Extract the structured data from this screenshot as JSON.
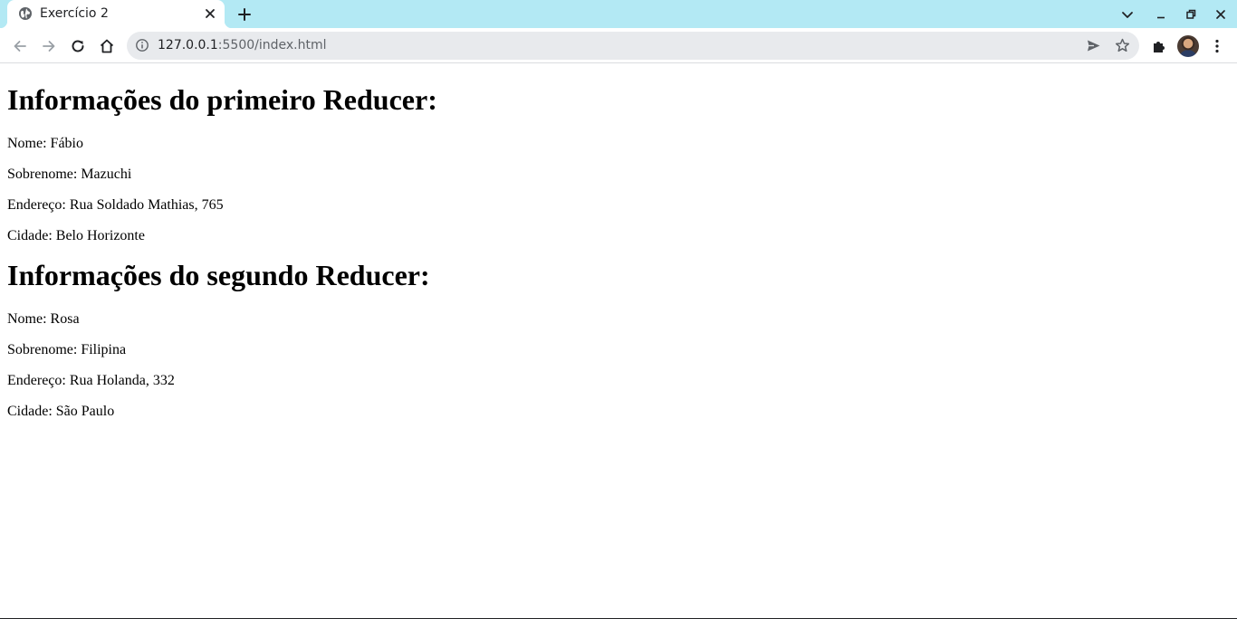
{
  "browser": {
    "tab": {
      "title": "Exercício 2",
      "favicon": "globe-icon"
    },
    "address_bar": {
      "host": "127.0.0.1",
      "rest": ":5500/index.html"
    },
    "icons": [
      "back-arrow-icon",
      "forward-arrow-icon",
      "reload-icon",
      "home-icon",
      "info-icon",
      "send-icon",
      "star-icon",
      "extensions-puzzle-icon",
      "kebab-menu-icon",
      "tab-search-chevron-icon",
      "minimize-icon",
      "restore-icon",
      "close-icon"
    ],
    "colors": {
      "tabstrip": "#b3e9f4",
      "omnibox": "#e8eaed"
    }
  },
  "page": {
    "sections": [
      {
        "heading": "Informações do primeiro Reducer:",
        "fields": [
          "Nome: Fábio",
          "Sobrenome: Mazuchi",
          "Endereço: Rua Soldado Mathias, 765",
          "Cidade: Belo Horizonte"
        ]
      },
      {
        "heading": "Informações do segundo Reducer:",
        "fields": [
          "Nome: Rosa",
          "Sobrenome: Filipina",
          "Endereço: Rua Holanda, 332",
          "Cidade: São Paulo"
        ]
      }
    ]
  }
}
